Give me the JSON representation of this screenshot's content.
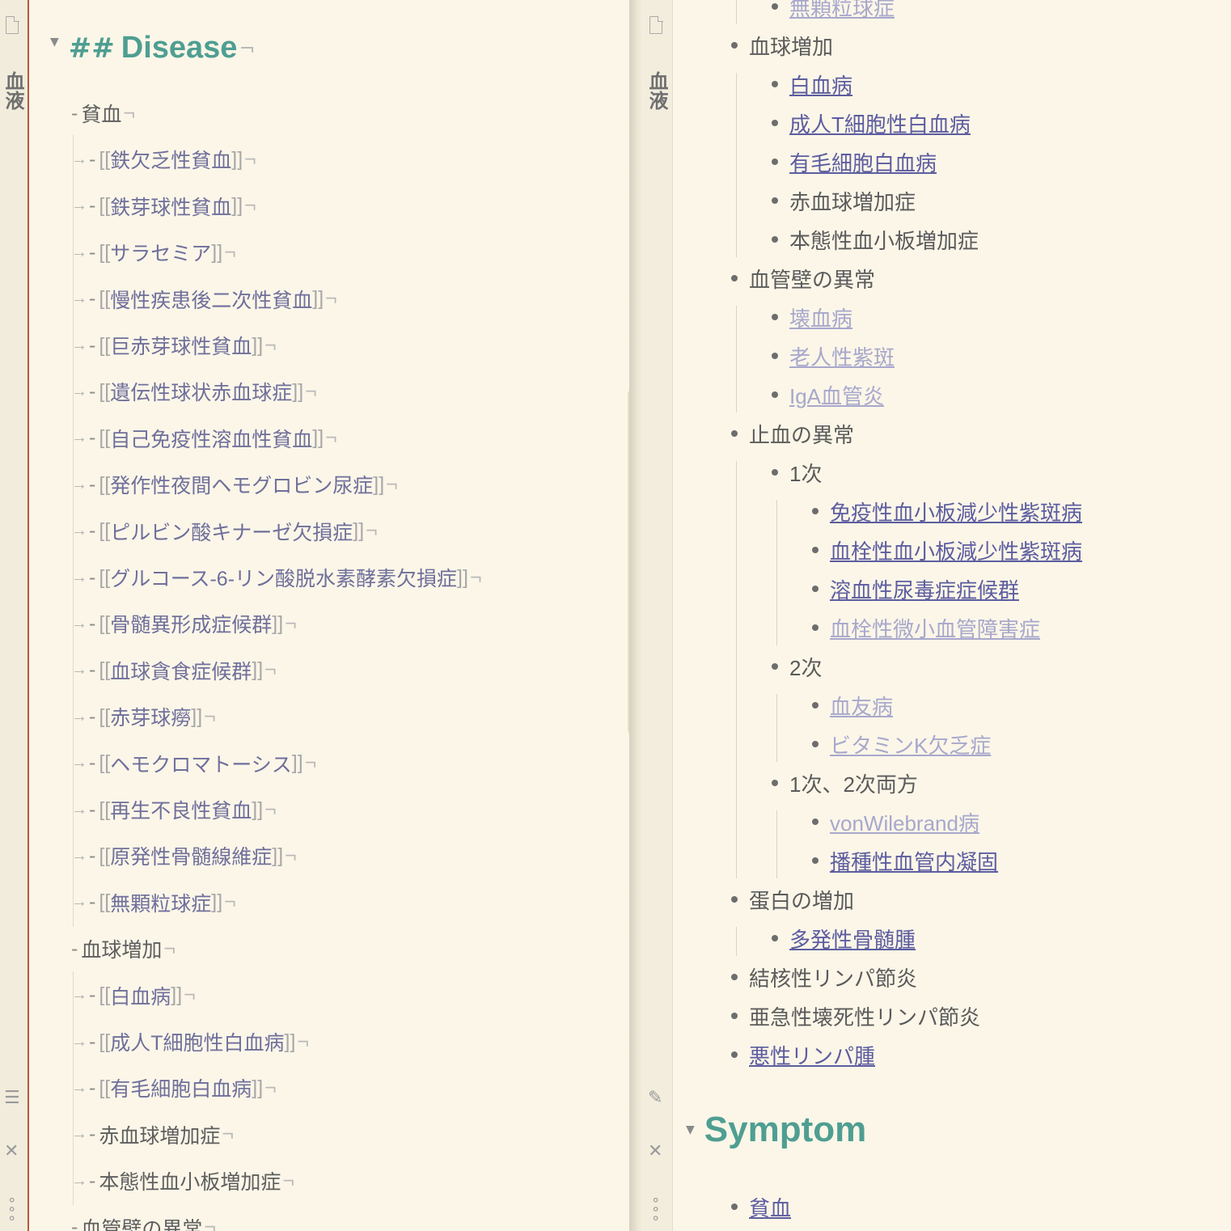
{
  "editor": {
    "side_title": "血液",
    "heading_hash": "##",
    "heading_text": "Disease",
    "pilcrow": "¬",
    "arrow": "→",
    "dash": "-",
    "lines": [
      {
        "level": 0,
        "text": "貧血",
        "link": false
      },
      {
        "level": 1,
        "text": "鉄欠乏性貧血",
        "link": true
      },
      {
        "level": 1,
        "text": "鉄芽球性貧血",
        "link": true
      },
      {
        "level": 1,
        "text": "サラセミア",
        "link": true
      },
      {
        "level": 1,
        "text": "慢性疾患後二次性貧血",
        "link": true
      },
      {
        "level": 1,
        "text": "巨赤芽球性貧血",
        "link": true
      },
      {
        "level": 1,
        "text": "遺伝性球状赤血球症",
        "link": true
      },
      {
        "level": 1,
        "text": "自己免疫性溶血性貧血",
        "link": true
      },
      {
        "level": 1,
        "text": "発作性夜間ヘモグロビン尿症",
        "link": true
      },
      {
        "level": 1,
        "text": "ピルビン酸キナーゼ欠損症",
        "link": true
      },
      {
        "level": 1,
        "text": "グルコース-6-リン酸脱水素酵素欠損症",
        "link": true
      },
      {
        "level": 1,
        "text": "骨髄異形成症候群",
        "link": true
      },
      {
        "level": 1,
        "text": "血球貪食症候群",
        "link": true
      },
      {
        "level": 1,
        "text": "赤芽球癆",
        "link": true
      },
      {
        "level": 1,
        "text": "ヘモクロマトーシス",
        "link": true
      },
      {
        "level": 1,
        "text": "再生不良性貧血",
        "link": true
      },
      {
        "level": 1,
        "text": "原発性骨髄線維症",
        "link": true
      },
      {
        "level": 1,
        "text": "無顆粒球症",
        "link": true
      },
      {
        "level": 0,
        "text": "血球増加",
        "link": false
      },
      {
        "level": 1,
        "text": "白血病",
        "link": true
      },
      {
        "level": 1,
        "text": "成人T細胞性白血病",
        "link": true
      },
      {
        "level": 1,
        "text": "有毛細胞白血病",
        "link": true
      },
      {
        "level": 1,
        "text": "赤血球増加症",
        "link": false
      },
      {
        "level": 1,
        "text": "本態性血小板増加症",
        "link": false
      },
      {
        "level": 0,
        "text": "血管壁の異常",
        "link": false
      }
    ]
  },
  "preview": {
    "side_title": "血液",
    "items": [
      {
        "level": 1,
        "text": "無顆粒球症",
        "style": "faint"
      },
      {
        "level": 0,
        "text": "血球増加",
        "style": "plain"
      },
      {
        "level": 1,
        "text": "白血病",
        "style": "link"
      },
      {
        "level": 1,
        "text": "成人T細胞性白血病",
        "style": "link"
      },
      {
        "level": 1,
        "text": "有毛細胞白血病",
        "style": "link"
      },
      {
        "level": 1,
        "text": "赤血球増加症",
        "style": "plain"
      },
      {
        "level": 1,
        "text": "本態性血小板増加症",
        "style": "plain"
      },
      {
        "level": 0,
        "text": "血管壁の異常",
        "style": "plain"
      },
      {
        "level": 1,
        "text": "壊血病",
        "style": "faint"
      },
      {
        "level": 1,
        "text": "老人性紫斑",
        "style": "faint"
      },
      {
        "level": 1,
        "text": "IgA血管炎",
        "style": "faint"
      },
      {
        "level": 0,
        "text": "止血の異常",
        "style": "plain"
      },
      {
        "level": 1,
        "text": "1次",
        "style": "plain"
      },
      {
        "level": 2,
        "text": "免疫性血小板減少性紫斑病",
        "style": "link"
      },
      {
        "level": 2,
        "text": "血栓性血小板減少性紫斑病",
        "style": "link"
      },
      {
        "level": 2,
        "text": "溶血性尿毒症症候群",
        "style": "link"
      },
      {
        "level": 2,
        "text": "血栓性微小血管障害症",
        "style": "faint"
      },
      {
        "level": 1,
        "text": "2次",
        "style": "plain"
      },
      {
        "level": 2,
        "text": "血友病",
        "style": "faint"
      },
      {
        "level": 2,
        "text": "ビタミンK欠乏症",
        "style": "faint"
      },
      {
        "level": 1,
        "text": "1次、2次両方",
        "style": "plain"
      },
      {
        "level": 2,
        "text": "vonWilebrand病",
        "style": "faint"
      },
      {
        "level": 2,
        "text": "播種性血管内凝固",
        "style": "link"
      },
      {
        "level": 0,
        "text": "蛋白の増加",
        "style": "plain"
      },
      {
        "level": 1,
        "text": "多発性骨髄腫",
        "style": "link"
      },
      {
        "level": 0,
        "text": "結核性リンパ節炎",
        "style": "plain"
      },
      {
        "level": 0,
        "text": "亜急性壊死性リンパ節炎",
        "style": "plain"
      },
      {
        "level": 0,
        "text": "悪性リンパ腫",
        "style": "link"
      }
    ],
    "symptom_heading": "Symptom",
    "symptom_items": [
      {
        "level": 0,
        "text": "貧血",
        "style": "link"
      }
    ]
  },
  "icons": {
    "document": "document-icon",
    "outline": "outline-icon",
    "close": "close-icon",
    "more": "more-icon",
    "pencil": "pencil-icon",
    "collapse": "collapse-triangle-icon"
  },
  "colors": {
    "background": "#fbf6e8",
    "heading": "#4f9e92",
    "link": "#5d5da0",
    "faint_link": "#a8a8cc",
    "gutter_accent": "#b5593e"
  }
}
